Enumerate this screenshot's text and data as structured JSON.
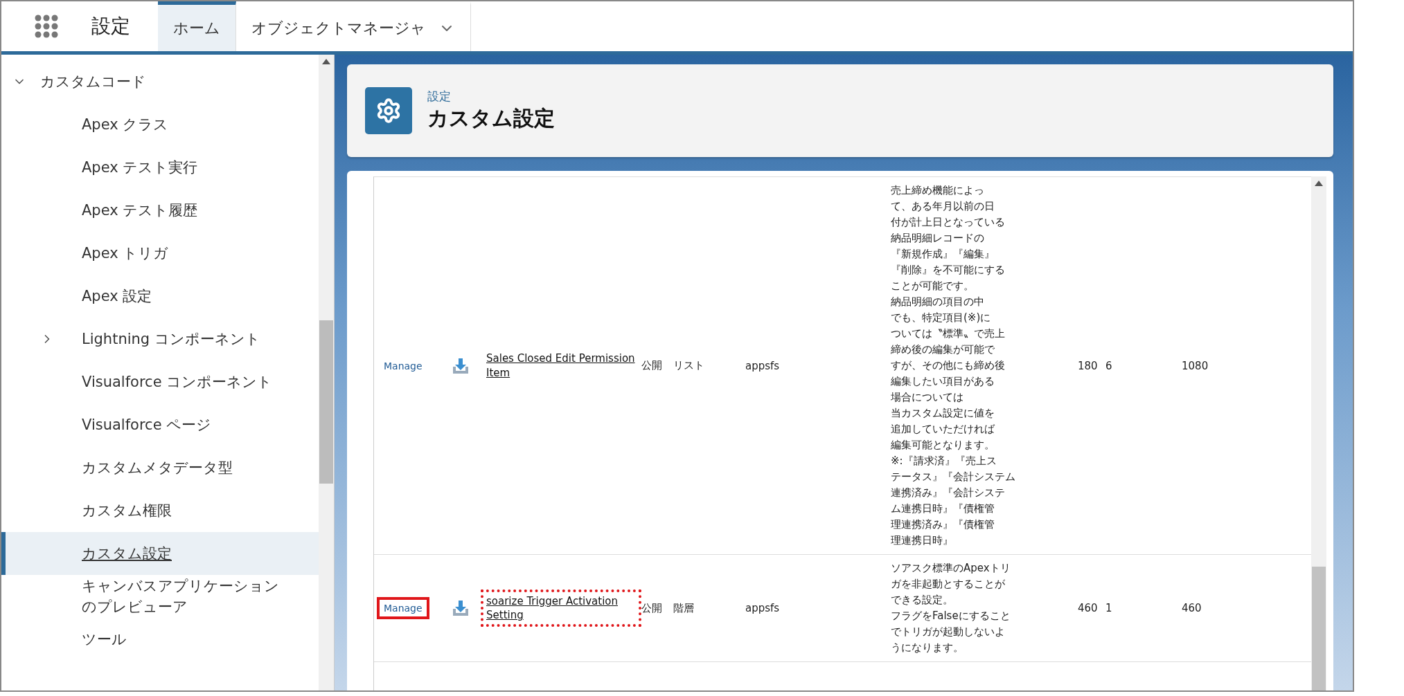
{
  "top_bar": {
    "app_title": "設定",
    "tabs": [
      {
        "label": "ホーム",
        "selected": true,
        "has_menu": false
      },
      {
        "label": "オブジェクトマネージャ",
        "selected": false,
        "has_menu": true
      }
    ]
  },
  "sidebar": {
    "items": [
      {
        "label": "カスタムコード",
        "selected": false,
        "expanded": true,
        "children": [
          {
            "label": "Apex クラス",
            "selected": false
          },
          {
            "label": "Apex テスト実行",
            "selected": false
          },
          {
            "label": "Apex テスト履歴",
            "selected": false
          },
          {
            "label": "Apex トリガ",
            "selected": false
          },
          {
            "label": "Apex 設定",
            "selected": false
          },
          {
            "label": "Lightning コンポーネント",
            "selected": false,
            "expanded": false
          },
          {
            "label": "Visualforce コンポーネント",
            "selected": false
          },
          {
            "label": "Visualforce ページ",
            "selected": false
          },
          {
            "label": "カスタムメタデータ型",
            "selected": false
          },
          {
            "label": "カスタム権限",
            "selected": false
          },
          {
            "label": "カスタム設定",
            "selected": true
          },
          {
            "label": "キャンバスアプリケーションのプレビューア",
            "selected": false
          },
          {
            "label": "ツール",
            "selected": false
          }
        ]
      }
    ]
  },
  "header": {
    "breadcrumb": "設定",
    "title": "カスタム設定"
  },
  "table": {
    "rows": [
      {
        "action": "Manage",
        "action_highlighted": false,
        "name": "Sales Closed Edit Permission Item",
        "name_highlighted": false,
        "column_3": "公開",
        "column_4": "リスト",
        "column_5": "appsfs",
        "column_6": [
          "売上締め機能によっ",
          "て、ある年月以前の日",
          "付が計上日となっている",
          "納品明細レコードの",
          "『新規作成』『編集』",
          "『削除』を不可能にする",
          "ことが可能です。",
          "納品明細の項目の中",
          "でも、特定項目(※)に",
          "ついては〝標準〟で売上",
          "締め後の編集が可能で",
          "すが、その他にも締め後",
          "編集したい項目がある",
          "場合については",
          "当カスタム設定に値を",
          "追加していただければ",
          "編集可能となります。",
          "※:『請求済』『売上ス",
          "テータス』『会計システム",
          "連携済み』『会計システ",
          "ム連携日時』『債権管",
          "理連携済み』『債権管",
          "理連携日時』"
        ],
        "column_7": "180",
        "column_8": "6",
        "column_9": "1080"
      },
      {
        "action": "Manage",
        "action_highlighted": true,
        "name": "soarize Trigger Activation Setting",
        "name_highlighted": true,
        "column_3": "公開",
        "column_4": "階層",
        "column_5": "appsfs",
        "column_6": [
          "ソアスク標準のApexトリ",
          "ガを非起動とすることが",
          "できる設定。",
          "フラグをFalseにすること",
          "でトリガが起動しないよ",
          "うになります。"
        ],
        "column_7": "460",
        "column_8": "1",
        "column_9": "460"
      }
    ]
  }
}
